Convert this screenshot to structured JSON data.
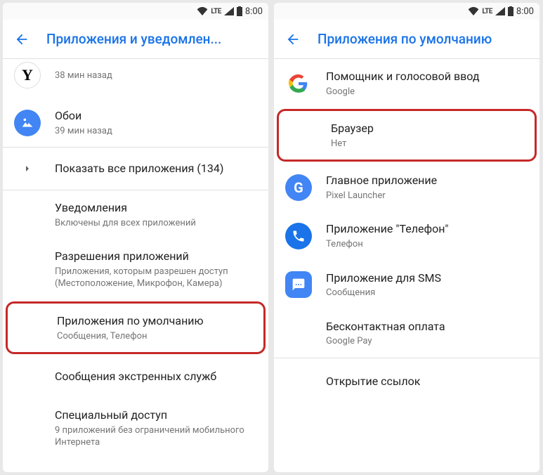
{
  "status": {
    "time": "8:00",
    "lte": "LTE"
  },
  "left": {
    "title": "Приложения и уведомлен...",
    "yandex_sub": "38 мин назад",
    "wallpaper_title": "Обои",
    "wallpaper_sub": "39 мин назад",
    "all_apps": "Показать все приложения (134)",
    "notif_title": "Уведомления",
    "notif_sub": "Включены для всех приложений",
    "perm_title": "Разрешения приложений",
    "perm_sub": "Приложения, которым разрешен доступ (Местоположение, Микрофон, Камера)",
    "default_title": "Приложения по умолчанию",
    "default_sub": "Сообщения, Телефон",
    "emergency_title": "Сообщения экстренных служб",
    "special_title": "Специальный доступ",
    "special_sub": "9 приложений без ограничений мобильного Интернета"
  },
  "right": {
    "title": "Приложения по умолчанию",
    "assist_title": "Помощник и голосовой ввод",
    "assist_sub": "Google",
    "browser_title": "Браузер",
    "browser_sub": "Нет",
    "home_title": "Главное приложение",
    "home_sub": "Pixel Launcher",
    "phone_title": "Приложение \"Телефон\"",
    "phone_sub": "Телефон",
    "sms_title": "Приложение для SMS",
    "sms_sub": "Сообщения",
    "nfc_title": "Бесконтактная оплата",
    "nfc_sub": "Google Pay",
    "links_title": "Открытие ссылок"
  }
}
